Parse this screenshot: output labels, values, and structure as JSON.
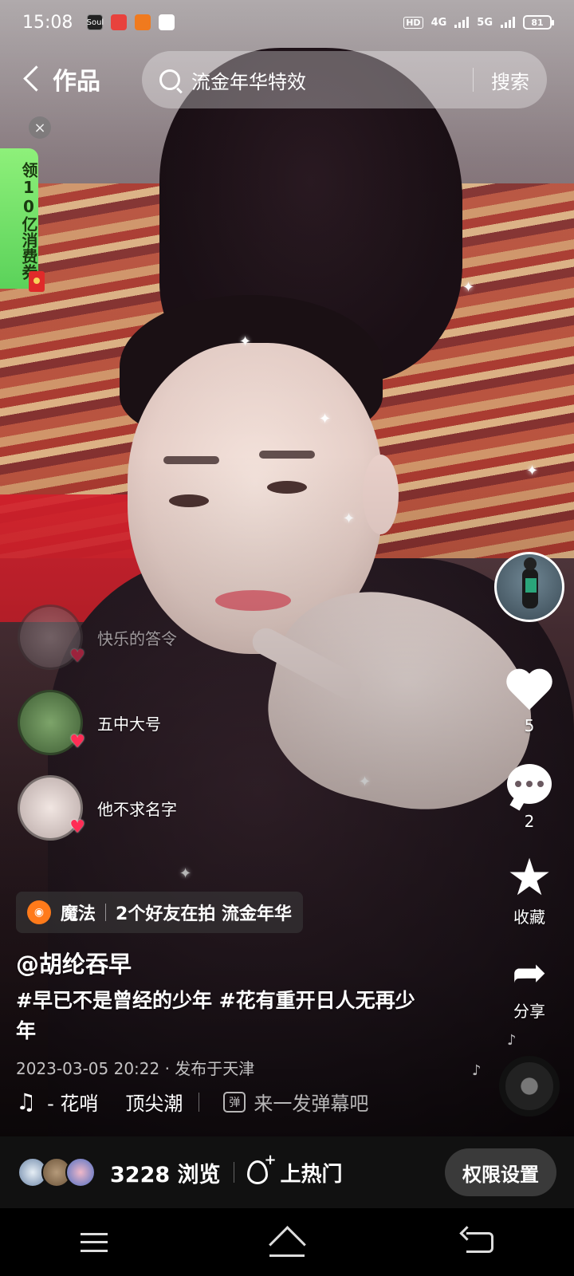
{
  "status_bar": {
    "time": "15:08",
    "apps": [
      "Soul",
      "",
      "",
      ""
    ],
    "network_hd": "HD",
    "net1": "4G",
    "net2": "5G",
    "battery": "81"
  },
  "header": {
    "back_icon": "chevron-left-icon",
    "title": "作品",
    "search_query": "流金年华特效",
    "search_button": "搜索"
  },
  "promo": {
    "text": "领10亿消费券",
    "close_icon": "close-icon"
  },
  "friends": [
    {
      "name": "快乐的答令"
    },
    {
      "name": "五中大号"
    },
    {
      "name": "他不求名字"
    }
  ],
  "rail": {
    "like_count": "5",
    "comment_count": "2",
    "favorite_label": "收藏",
    "share_label": "分享"
  },
  "effect_tag": {
    "name": "魔法",
    "text": "2个好友在拍 流金年华"
  },
  "post": {
    "author": "@胡纶吞早",
    "caption": "#早已不是曾经的少年 #花有重开日人无再少年",
    "meta": "2023-03-05 20:22 · 发布于天津",
    "music": "- 花哨",
    "music_author": "顶尖潮",
    "danmaku_placeholder": "来一发弹幕吧"
  },
  "bottom_bar": {
    "views": "3228 浏览",
    "hot_label": "上热门",
    "permission_button": "权限设置"
  },
  "colors": {
    "like_red": "#ff2d55",
    "promo_green": "#5bd25a",
    "effect_orange": "#ff7a1a"
  }
}
